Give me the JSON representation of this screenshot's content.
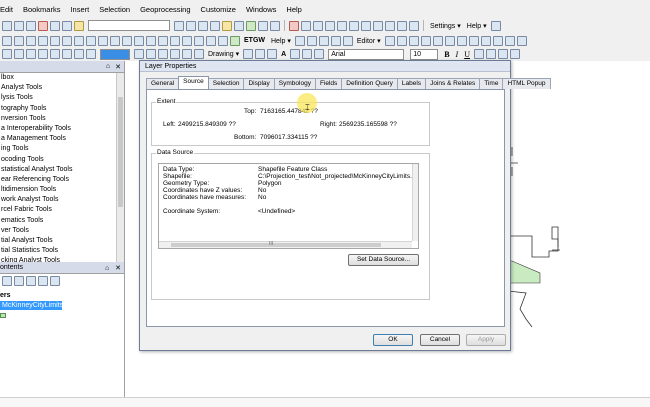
{
  "menu": [
    "Edit",
    "Bookmarks",
    "Insert",
    "Selection",
    "Geoprocessing",
    "Customize",
    "Windows",
    "Help"
  ],
  "toolbar": {
    "settings_label": "Settings ▾",
    "help_label": "Help ▾",
    "help2_label": "Help ▾",
    "editor_label": "Editor ▾",
    "drawing_label": "Drawing ▾",
    "font_name": "Arial",
    "font_size": "10",
    "etgw_label": "ETGW"
  },
  "toolbox": {
    "items": [
      "lbox",
      "Analyst Tools",
      "lysis Tools",
      "tography Tools",
      "nversion Tools",
      "a Interoperability Tools",
      "a Management Tools",
      "ing Tools",
      "ocoding Tools",
      "statistical Analyst Tools",
      "ear Referencing Tools",
      "ltidimension Tools",
      "work Analyst Tools",
      "rcel Fabric Tools",
      "ematics Tools",
      "ver Tools",
      "tial Analyst Tools",
      "tial Statistics Tools",
      "cking Analyst Tools"
    ]
  },
  "toc": {
    "title": "ontents",
    "layers_label": "ers",
    "layer_name": "McKinneyCityLimits"
  },
  "dialog": {
    "title": "Layer Properties",
    "tabs": [
      "General",
      "Source",
      "Selection",
      "Display",
      "Symbology",
      "Fields",
      "Definition Query",
      "Labels",
      "Joins & Relates",
      "Time",
      "HTML Popup"
    ],
    "extent": {
      "label": "Extent",
      "top_label": "Top:",
      "top_value": "7163165.447842 ??",
      "left_label": "Left:",
      "left_value": "2499215.849309 ??",
      "right_label": "Right:",
      "right_value": "2569235.165598 ??",
      "bottom_label": "Bottom:",
      "bottom_value": "7096017.334115 ??"
    },
    "data_source": {
      "label": "Data Source",
      "rows": [
        {
          "key": "Data Type:",
          "value": "Shapefile Feature Class"
        },
        {
          "key": "Shapefile:",
          "value": "C:\\Projection_test\\Not_projected\\McKinneyCityLimits.sh"
        },
        {
          "key": "Geometry Type:",
          "value": "Polygon"
        },
        {
          "key": "Coordinates have Z values:",
          "value": "No"
        },
        {
          "key": "Coordinates have measures:",
          "value": "No"
        },
        {
          "key": "",
          "value": ""
        },
        {
          "key": "Coordinate System:",
          "value": "<Undefined>"
        }
      ],
      "scroll_label": "III",
      "set_button": "Set Data Source..."
    },
    "buttons": {
      "ok": "OK",
      "cancel": "Cancel",
      "apply": "Apply"
    }
  }
}
